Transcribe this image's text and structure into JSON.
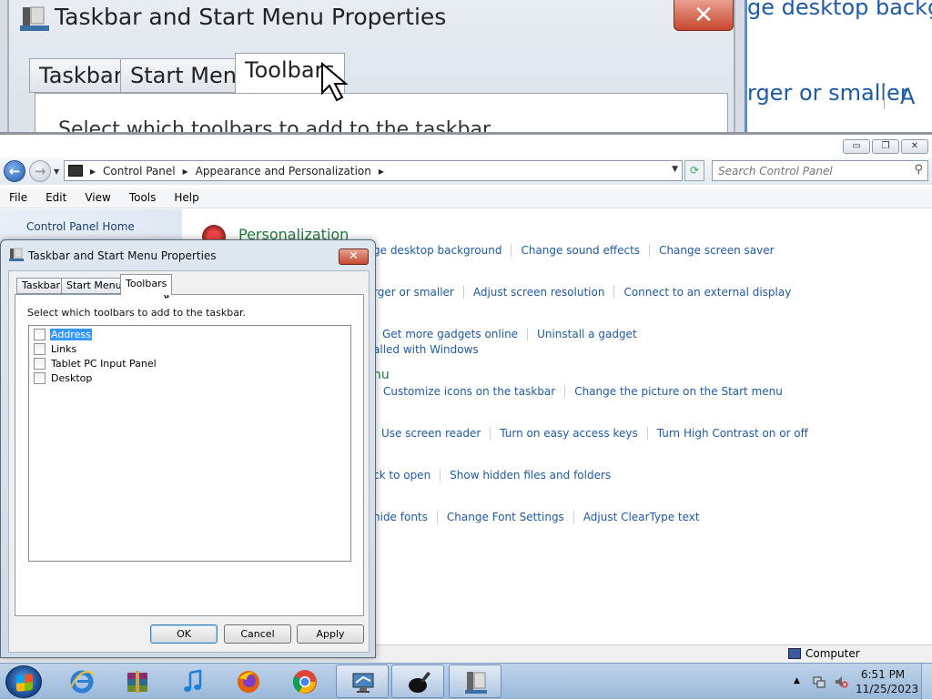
{
  "zoom": {
    "title": "Taskbar and Start Menu Properties",
    "close_label": "✕",
    "tabs": [
      "Taskbar",
      "Start Menu",
      "Toolbars"
    ],
    "cut_text": "Select which toolbars to add to the taskbar",
    "right_text_1": "ge desktop backgro",
    "right_text_2": "rger or smaller",
    "right_text_3": "A"
  },
  "explorer": {
    "caption_buttons": {
      "minimize": "▭",
      "maximize": "❐",
      "close": "✕"
    },
    "breadcrumb": [
      "Control Panel",
      "Appearance and Personalization"
    ],
    "search_placeholder": "Search Control Panel",
    "menu": [
      "File",
      "Edit",
      "View",
      "Tools",
      "Help"
    ],
    "left_pane": {
      "home": "Control Panel Home"
    },
    "category_title": "Personalization",
    "rows": [
      [
        "ge desktop background",
        "Change sound effects",
        "Change screen saver"
      ],
      [
        "rger or smaller",
        "Adjust screen resolution",
        "Connect to an external display"
      ],
      [
        "Get more gadgets online",
        "Uninstall a gadget"
      ],
      [
        "alled with Windows"
      ],
      [
        "nu"
      ],
      [
        "Customize icons on the taskbar",
        "Change the picture on the Start menu"
      ],
      [
        "Use screen reader",
        "Turn on easy access keys",
        "Turn High Contrast on or off"
      ],
      [
        "ck to open",
        "Show hidden files and folders"
      ],
      [
        "hide fonts",
        "Change Font Settings",
        "Adjust ClearType text"
      ]
    ],
    "status": "Computer"
  },
  "dialog": {
    "title": "Taskbar and Start Menu Properties",
    "close_label": "✕",
    "tabs": [
      "Taskbar",
      "Start Menu",
      "Toolbars"
    ],
    "instruction": "Select which toolbars to add to the taskbar.",
    "toolbars": [
      {
        "label": "Address",
        "checked": false,
        "selected": true
      },
      {
        "label": "Links",
        "checked": false,
        "selected": false
      },
      {
        "label": "Tablet PC Input Panel",
        "checked": false,
        "selected": false
      },
      {
        "label": "Desktop",
        "checked": false,
        "selected": false
      }
    ],
    "buttons": {
      "ok": "OK",
      "cancel": "Cancel",
      "apply": "Apply"
    }
  },
  "taskbar": {
    "apps": [
      "internet-explorer-icon",
      "winrar-icon",
      "itunes-icon",
      "firefox-icon",
      "chrome-icon",
      "remote-desktop-icon",
      "paint-icon",
      "taskbar-properties-icon"
    ],
    "time": "6:51 PM",
    "date": "11/25/2023"
  },
  "colors": {
    "link": "#1e5aa8",
    "category": "#1e7a3a",
    "selection": "#3399ff"
  }
}
